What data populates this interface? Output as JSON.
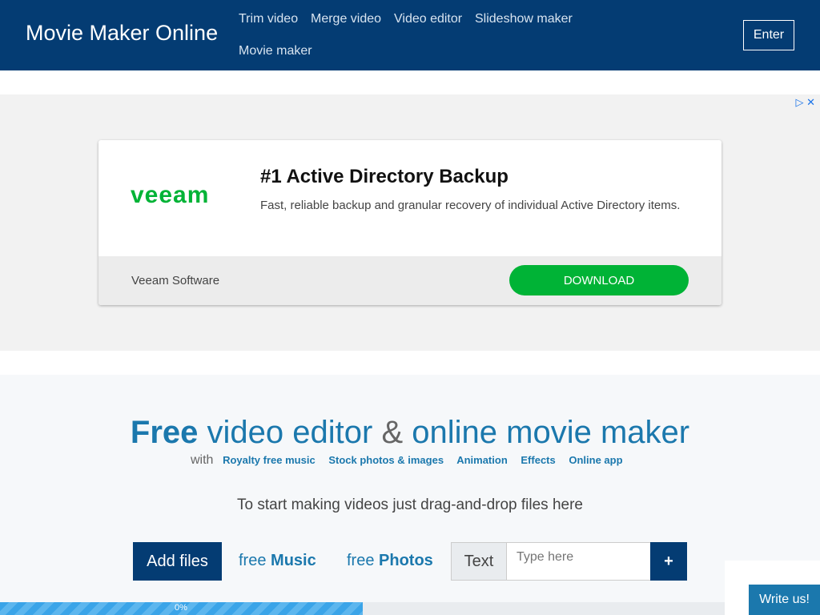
{
  "header": {
    "brand": "Movie Maker Online",
    "nav": [
      "Trim video",
      "Merge video",
      "Video editor",
      "Slideshow maker",
      "Movie maker"
    ],
    "enter": "Enter"
  },
  "ad": {
    "logo": "veeam",
    "title": "#1 Active Directory Backup",
    "description": "Fast, reliable backup and granular recovery of individual Active Directory items.",
    "advertiser": "Veeam Software",
    "cta": "DOWNLOAD",
    "icons": [
      "adchoices-icon",
      "close-icon"
    ]
  },
  "main": {
    "title_bold": "Free",
    "title_part1": "video editor",
    "title_amp": "&",
    "title_part2": "online movie maker",
    "with": "with",
    "links": [
      "Royalty free music",
      "Stock photos & images",
      "Animation",
      "Effects",
      "Online app"
    ],
    "drag_text": "To start making videos just drag-and-drop files here",
    "add_files": "Add files",
    "free_music_prefix": "free",
    "free_music": "Music",
    "free_photos_prefix": "free",
    "free_photos": "Photos",
    "text_label": "Text",
    "text_placeholder": "Type here",
    "plus": "+",
    "progress_label": "0%",
    "progress_fill": 0.5
  },
  "chat": {
    "label": "Write us!"
  }
}
